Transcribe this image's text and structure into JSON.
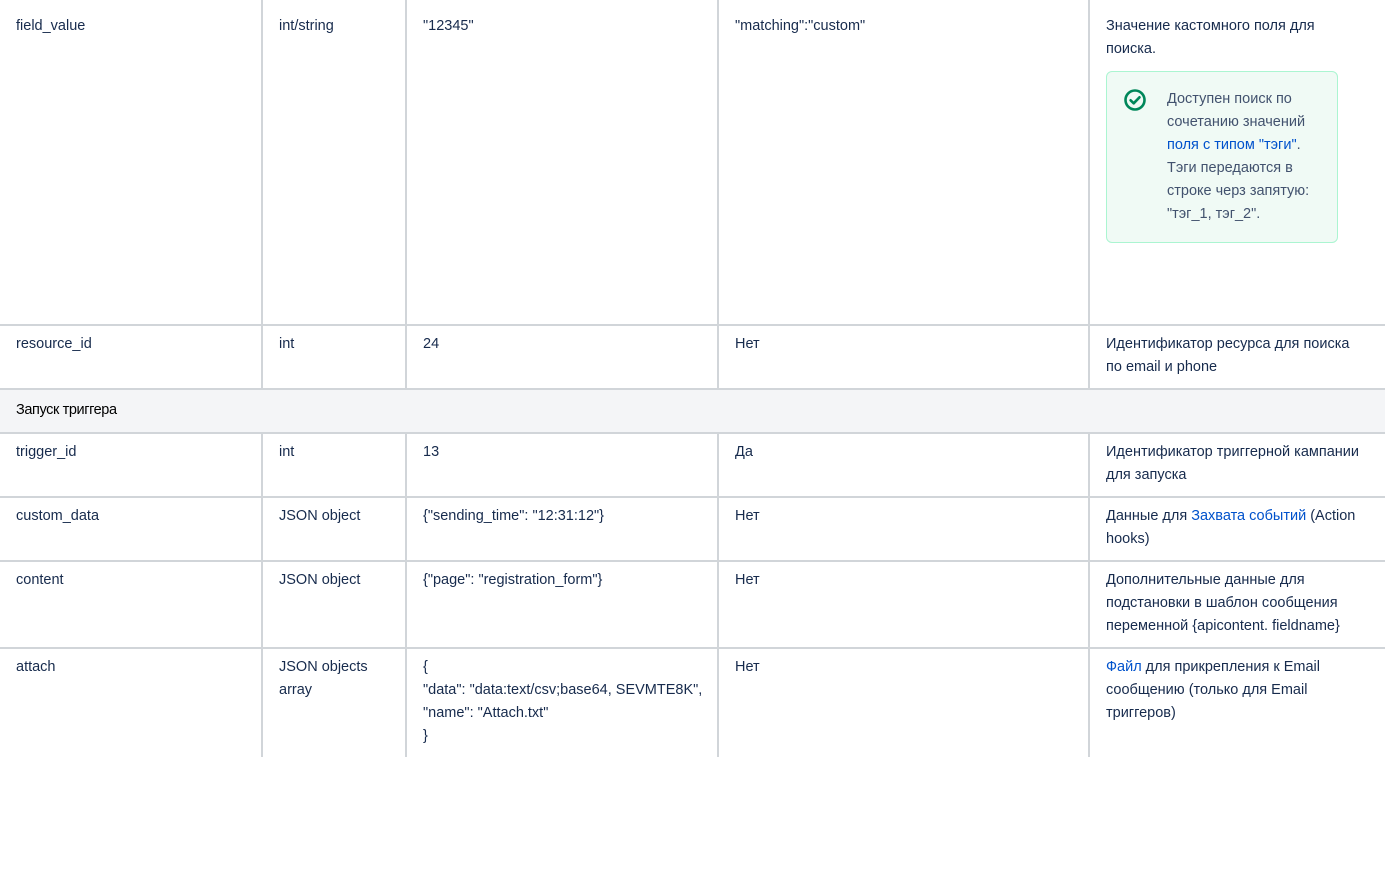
{
  "rows": [
    {
      "name": "field_value",
      "type": "int/string",
      "example": "\"12345\"",
      "required": "\"matching\":\"custom\"",
      "description": "Значение кастомного поля для поиска.",
      "note": {
        "icon": "check-circle-icon",
        "text_before": "Доступен поиск по сочетанию значений ",
        "link_text": "поля с типом \"тэги\"",
        "text_after": ". Тэги передаются в строке черз запятую: \"тэг_1, тэг_2\"."
      }
    },
    {
      "name": "resource_id",
      "type": "int",
      "example": "24",
      "required": "Нет",
      "description": "Идентификатор ресурса для поиска по email и phone"
    }
  ],
  "section": {
    "title": "Запуск триггера"
  },
  "trigger_rows": [
    {
      "name": "trigger_id",
      "type": "int",
      "example": "13",
      "required": "Да",
      "description": "Идентификатор триггерной кампании для запуска"
    },
    {
      "name": "custom_data",
      "type": "JSON object",
      "example": "{\"sending_time\": \"12:31:12\"}",
      "required": "Нет",
      "description_before": "Данные для ",
      "description_link": "Захвата событий",
      "description_after": " (Action hooks)"
    },
    {
      "name": "content",
      "type": "JSON object",
      "example": "{\"page\": \"registration_form\"}",
      "required": "Нет",
      "description_line1": "Дополнительные данные для подстановки в шаблон сообщения",
      "description_line2": "переменной {apicontent. fieldname}"
    },
    {
      "name": "attach",
      "type": "JSON objects array",
      "example_lines": [
        "{",
        "\"data\": \"data:text/csv;base64, SEVMTE8K\",",
        "\"name\": \"Attach.txt\"",
        "}"
      ],
      "required": "Нет",
      "description_link": "Файл",
      "description_after": " для прикрепления к Email сообщению (только для Email триггеров)"
    }
  ],
  "colors": {
    "link": "#0052cc",
    "border": "#d1d5d9",
    "section_bg": "#f4f5f7",
    "success_border": "#abf5d1",
    "success_bg": "#f0faf5",
    "success_icon": "#00875a"
  }
}
